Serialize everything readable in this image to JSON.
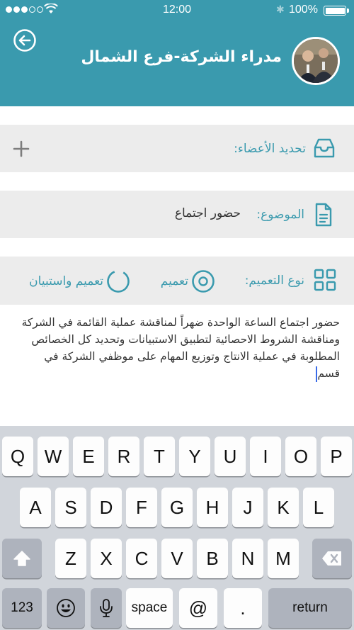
{
  "status_bar": {
    "time": "12:00",
    "battery": "100%"
  },
  "header": {
    "title": "مدراء الشركة-فرع الشمال"
  },
  "members_row": {
    "label": "تحديد الأعضاء:"
  },
  "subject_row": {
    "label": "الموضوع:",
    "value": "حضور اجتماع"
  },
  "type_row": {
    "label": "نوع التعميم:",
    "options": [
      {
        "label": "تعميم",
        "selected": true
      },
      {
        "label": "تعميم واستبيان",
        "selected": false
      }
    ]
  },
  "body": {
    "text": "حضور اجتماع الساعة الواحدة ضهراً لمناقشة عملية القائمة في الشركة ومناقشة الشروط الاحصائية لتطبيق الاستبيانات وتحديد كل الخصائص المطلوبة في عملية الانتاج وتوزيع المهام على موظفي الشركة في قسم"
  },
  "keyboard": {
    "row1": [
      "Q",
      "W",
      "E",
      "R",
      "T",
      "Y",
      "U",
      "I",
      "O",
      "P"
    ],
    "row2": [
      "A",
      "S",
      "D",
      "F",
      "G",
      "H",
      "J",
      "K",
      "L"
    ],
    "row3": [
      "Z",
      "X",
      "C",
      "V",
      "B",
      "N",
      "M"
    ],
    "numbers_key": "123",
    "space_key": "space",
    "at_key": "@",
    "dot_key": ".",
    "return_key": "return"
  },
  "colors": {
    "accent": "#3a9aae",
    "row_bg": "#ececec",
    "keyboard_bg": "#d1d5db"
  },
  "icons": [
    "back-arrow-icon",
    "inbox-icon",
    "plus-icon",
    "document-icon",
    "grid-icon",
    "radio-selected-icon",
    "radio-unselected-icon",
    "shift-icon",
    "backspace-icon",
    "emoji-icon",
    "microphone-icon"
  ]
}
